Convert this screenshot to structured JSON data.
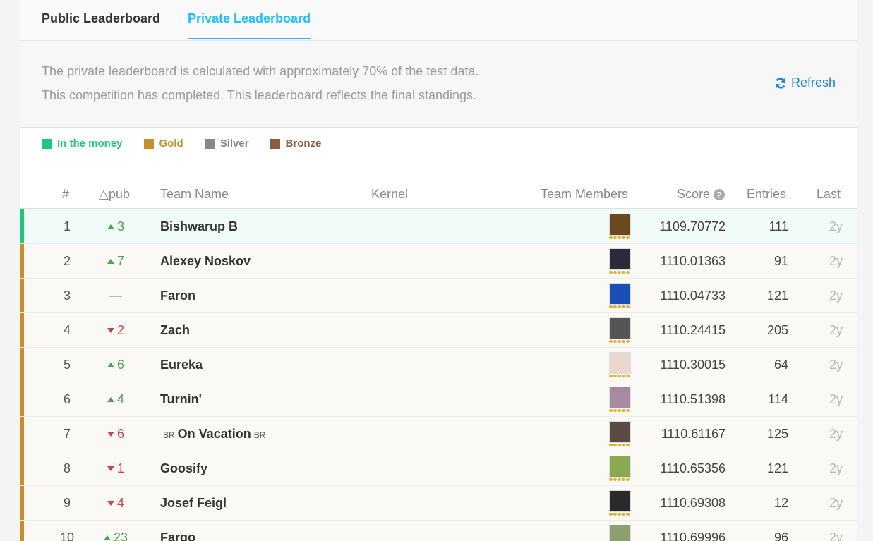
{
  "tabs": [
    {
      "label": "Public Leaderboard",
      "active": false
    },
    {
      "label": "Private Leaderboard",
      "active": true
    }
  ],
  "info": {
    "line1": "The private leaderboard is calculated with approximately 70% of the test data.",
    "line2": "This competition has completed. This leaderboard reflects the final standings.",
    "refresh_label": "Refresh",
    "refresh_icon": "refresh-icon"
  },
  "legend": [
    {
      "label": "In the money",
      "color": "#20c67a"
    },
    {
      "label": "Gold",
      "color": "#c58f2c"
    },
    {
      "label": "Silver",
      "color": "#888888"
    },
    {
      "label": "Bronze",
      "color": "#8c5a3c"
    }
  ],
  "columns": {
    "rank": "#",
    "delta": "△pub",
    "team": "Team Name",
    "kernel": "Kernel",
    "members": "Team Members",
    "score": "Score",
    "entries": "Entries",
    "last": "Last"
  },
  "colors": {
    "money_bar": "#20c67a",
    "gold_bar": "#c58f2c",
    "accent": "#20beff"
  },
  "rows": [
    {
      "rank": "1",
      "dir": "up",
      "delta": "3",
      "team": "Bishwarup B",
      "score": "1109.70772",
      "entries": "111",
      "last": "2y",
      "tier": "money",
      "avatar": "#6b4a20"
    },
    {
      "rank": "2",
      "dir": "up",
      "delta": "7",
      "team": "Alexey Noskov",
      "score": "1110.01363",
      "entries": "91",
      "last": "2y",
      "tier": "gold",
      "avatar": "#2a2a3a"
    },
    {
      "rank": "3",
      "dir": "none",
      "delta": "—",
      "team": "Faron",
      "score": "1110.04733",
      "entries": "121",
      "last": "2y",
      "tier": "gold",
      "avatar": "#1a4fb8"
    },
    {
      "rank": "4",
      "dir": "down",
      "delta": "2",
      "team": "Zach",
      "score": "1110.24415",
      "entries": "205",
      "last": "2y",
      "tier": "gold",
      "avatar": "#555555"
    },
    {
      "rank": "5",
      "dir": "up",
      "delta": "6",
      "team": "Eureka",
      "score": "1110.30015",
      "entries": "64",
      "last": "2y",
      "tier": "gold",
      "avatar": "#e8d8d0"
    },
    {
      "rank": "6",
      "dir": "up",
      "delta": "4",
      "team": "Turnin'",
      "score": "1110.51398",
      "entries": "114",
      "last": "2y",
      "tier": "gold",
      "avatar": "#a88aa0"
    },
    {
      "rank": "7",
      "dir": "down",
      "delta": "6",
      "team": "On Vacation",
      "tag": "BR",
      "score": "1110.61167",
      "entries": "125",
      "last": "2y",
      "tier": "gold",
      "avatar": "#5a4a40"
    },
    {
      "rank": "8",
      "dir": "down",
      "delta": "1",
      "team": "Goosify",
      "score": "1110.65356",
      "entries": "121",
      "last": "2y",
      "tier": "gold",
      "avatar": "#8aa850"
    },
    {
      "rank": "9",
      "dir": "down",
      "delta": "4",
      "team": "Josef Feigl",
      "score": "1110.69308",
      "entries": "12",
      "last": "2y",
      "tier": "gold",
      "avatar": "#2a2a2a"
    },
    {
      "rank": "10",
      "dir": "up",
      "delta": "23",
      "team": "Fargo",
      "score": "1110.69996",
      "entries": "96",
      "last": "2y",
      "tier": "gold",
      "avatar": "#8aa070"
    }
  ]
}
